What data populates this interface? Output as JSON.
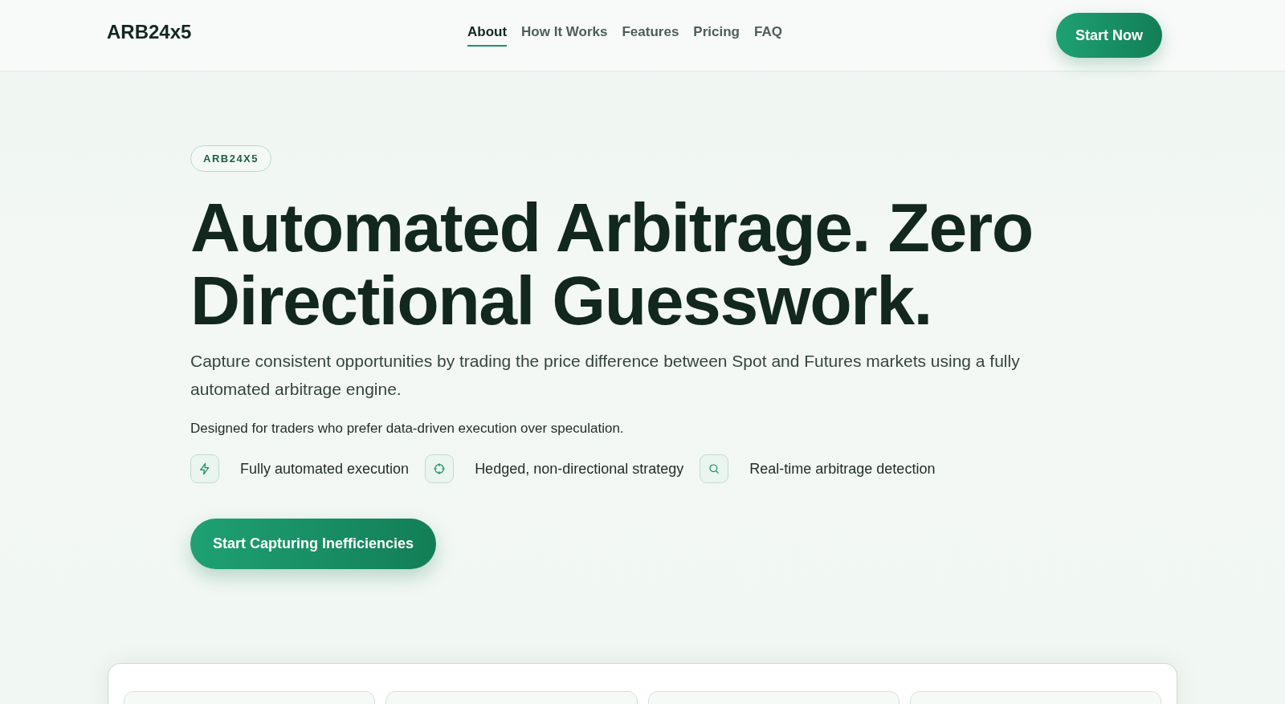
{
  "header": {
    "logo": "ARB24x5",
    "nav": [
      {
        "label": "About",
        "selected": true
      },
      {
        "label": "How It Works",
        "selected": false
      },
      {
        "label": "Features",
        "selected": false
      },
      {
        "label": "Pricing",
        "selected": false
      },
      {
        "label": "FAQ",
        "selected": false
      }
    ],
    "cta": "Start Now"
  },
  "hero": {
    "badge": "ARB24X5",
    "headline": "Automated Arbitrage. Zero Directional Guesswork.",
    "lead": "Capture consistent opportunities by trading the price difference between Spot and Futures markets using a fully automated arbitrage engine.",
    "note": "Designed for traders who prefer data-driven execution over speculation.",
    "features": [
      {
        "kind": "bolt",
        "label": "Fully automated execution"
      },
      {
        "kind": "crosshair",
        "label": "Hedged, non-directional strategy"
      },
      {
        "kind": "search",
        "label": "Real-time arbitrage detection"
      }
    ],
    "cta": "Start Capturing Inefficiencies"
  }
}
